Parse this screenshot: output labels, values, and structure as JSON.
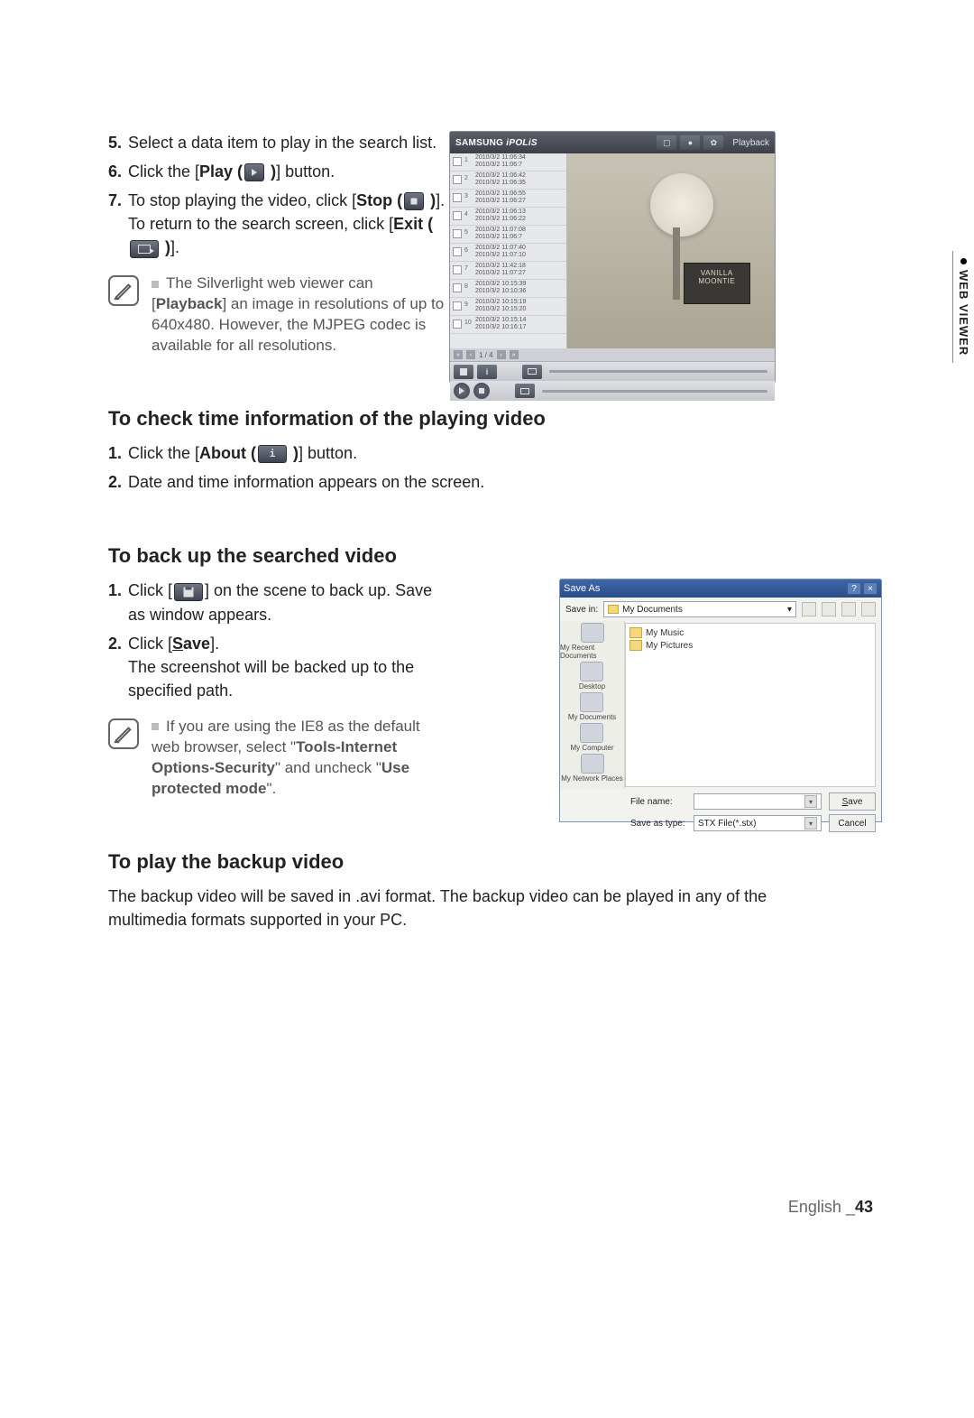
{
  "tab_label": "WEB VIEWER",
  "steps_a": [
    {
      "n": "5.",
      "text": "Select a data item to play in the search list."
    },
    {
      "n": "6.",
      "parts": [
        "Click the [",
        {
          "b": "Play ("
        },
        {
          "icon": "play"
        },
        {
          "b": " )"
        },
        "] button."
      ]
    },
    {
      "n": "7.",
      "parts": [
        "To stop playing the video, click [",
        {
          "b": "Stop ("
        },
        {
          "icon": "stop"
        },
        {
          "b": " )"
        },
        "].",
        {
          "br": true
        },
        "To return to the search screen, click [",
        {
          "b": "Exit ("
        },
        {
          "icon": "exit"
        },
        {
          "b": " )"
        },
        "]."
      ]
    }
  ],
  "note_a": {
    "parts": [
      "The Silverlight web viewer can [",
      {
        "b": "Playback"
      },
      "] an image in resolutions of up to 640x480. However, the MJPEG codec is available for all resolutions."
    ]
  },
  "sec1": "To check time information of the playing video",
  "steps_b": [
    {
      "n": "1.",
      "parts": [
        "Click the [",
        {
          "b": "About ("
        },
        {
          "icon": "info"
        },
        {
          "b": " )"
        },
        "] button."
      ]
    },
    {
      "n": "2.",
      "text": "Date and time information appears on the screen."
    }
  ],
  "sec2": "To back up the searched video",
  "steps_c": [
    {
      "n": "1.",
      "parts": [
        "Click [",
        {
          "icon": "disk"
        },
        "] on the scene to back up. Save as window appears."
      ]
    },
    {
      "n": "2.",
      "parts": [
        "Click [",
        {
          "bu": "S",
          "rest": "ave"
        },
        "].",
        {
          "br": true
        },
        "The screenshot will be backed up to the specified path."
      ]
    }
  ],
  "note_c": {
    "parts": [
      "If you are using the IE8 as the default web browser, select \"",
      {
        "b": "Tools-Internet Options-Security"
      },
      "\" and uncheck \"",
      {
        "b": "Use protected mode"
      },
      "\"."
    ]
  },
  "sec3": "To play the backup video",
  "body3": "The backup video will be saved in .avi format. The backup video can be played in any of the multimedia formats supported in your PC.",
  "footer": {
    "lang": "English _",
    "page": "43"
  },
  "shot1": {
    "logo_a": "SAMSUNG ",
    "logo_b": "iPOLiS",
    "playback": "Playback",
    "rows": [
      {
        "i": "1",
        "a": "2010/3/2 11:06:34",
        "b": "2010/3/2 11:06:7"
      },
      {
        "i": "2",
        "a": "2010/3/2 11:06:42",
        "b": "2010/3/2 11:06:35"
      },
      {
        "i": "3",
        "a": "2010/3/2 11:06:55",
        "b": "2010/3/2 11:06:27"
      },
      {
        "i": "4",
        "a": "2010/3/2 11:06:13",
        "b": "2010/3/2 11:06:22"
      },
      {
        "i": "5",
        "a": "2010/3/2 11:07:08",
        "b": "2010/3/2 11:06:7"
      },
      {
        "i": "6",
        "a": "2010/3/2 11:07:40",
        "b": "2010/3/2 11:07:10"
      },
      {
        "i": "7",
        "a": "2010/3/2 11:42:18",
        "b": "2010/3/2 11:07:27"
      },
      {
        "i": "8",
        "a": "2010/3/2 10:15:39",
        "b": "2010/3/2 10:10:36"
      },
      {
        "i": "9",
        "a": "2010/3/2 10:15:19",
        "b": "2010/3/2 10:15:20"
      },
      {
        "i": "10",
        "a": "2010/3/2 10:15:14",
        "b": "2010/3/2 10:16:17"
      }
    ],
    "box_lbl": "VANILLA MOONTIE",
    "pager": "1 / 4"
  },
  "shot2": {
    "title": "Save As",
    "savein_lbl": "Save in:",
    "savein_val": "My Documents",
    "folders": [
      "My Music",
      "My Pictures"
    ],
    "side": [
      "My Recent Documents",
      "Desktop",
      "My Documents",
      "My Computer",
      "My Network Places"
    ],
    "fname_lbl": "File name:",
    "fname_val": "",
    "ftype_lbl": "Save as type:",
    "ftype_val": "STX File(*.stx)",
    "save_btn": "Save",
    "cancel_btn": "Cancel"
  }
}
